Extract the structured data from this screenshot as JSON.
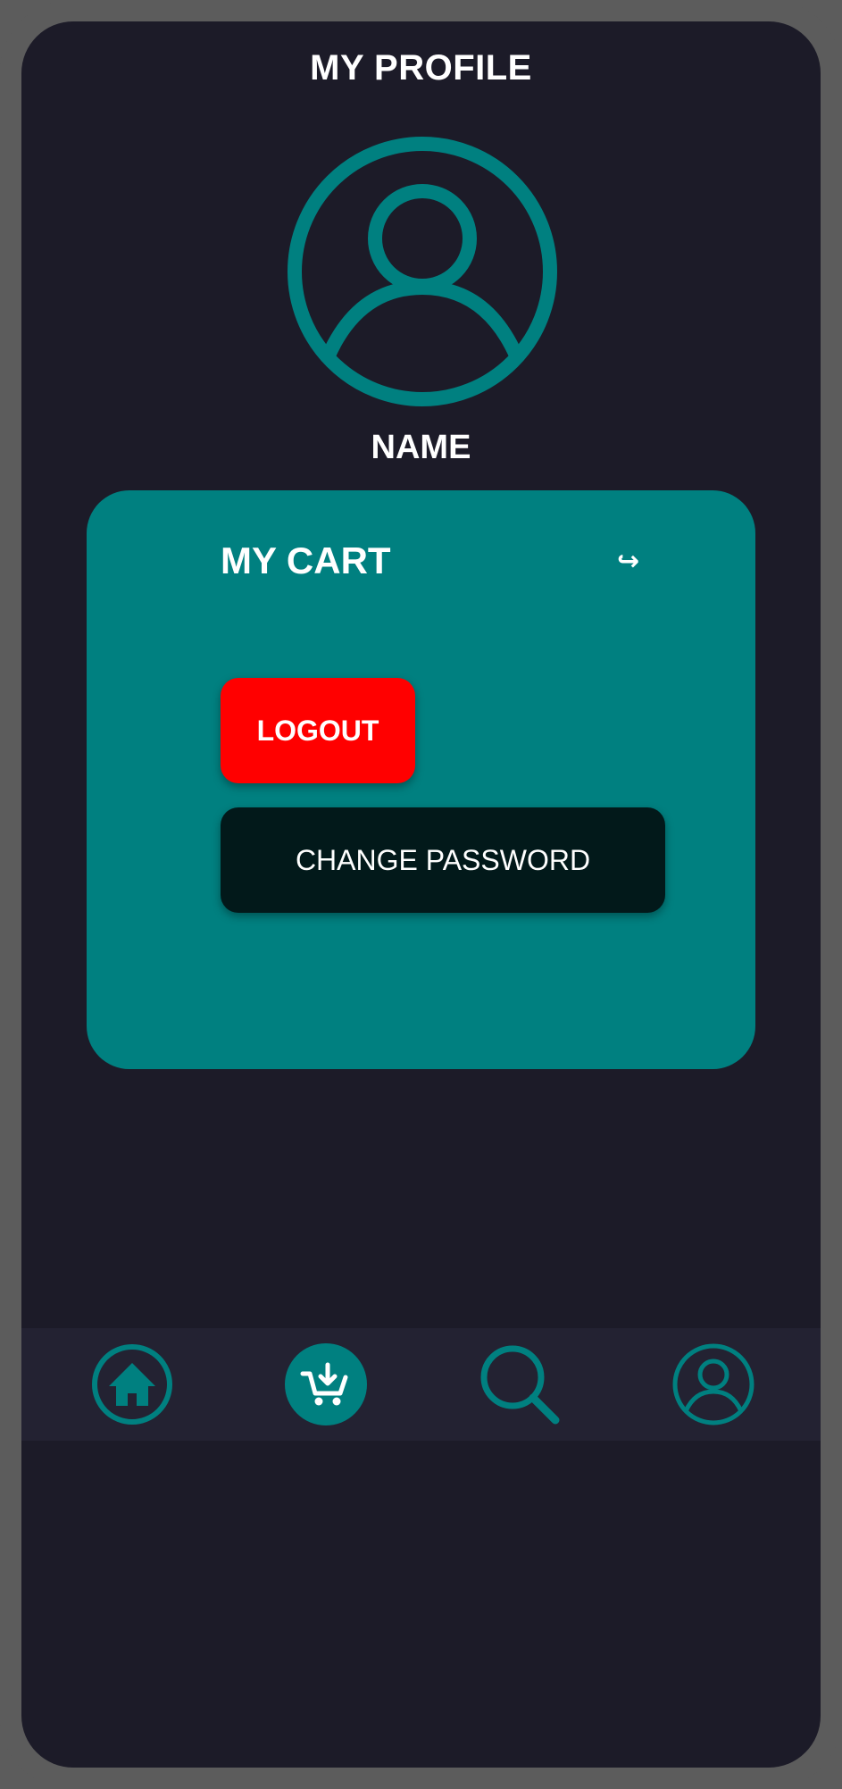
{
  "header": {
    "title": "MY PROFILE"
  },
  "profile": {
    "name": "NAME",
    "avatar_icon": "user-circle-icon"
  },
  "card": {
    "cart_label": "MY CART",
    "cart_arrow": "↪",
    "logout_label": "LOGOUT",
    "change_password_label": "CHANGE PASSWORD"
  },
  "bottom_nav": {
    "items": [
      {
        "icon": "home-icon",
        "active": false
      },
      {
        "icon": "cart-download-icon",
        "active": true
      },
      {
        "icon": "search-icon",
        "active": false
      },
      {
        "icon": "profile-icon",
        "active": false
      }
    ]
  },
  "colors": {
    "background": "#1c1b28",
    "frame": "#5c5c5c",
    "accent": "#008080",
    "danger": "#ff0000",
    "dark_button": "#02191a",
    "nav_bar": "#232232",
    "text": "#ffffff"
  }
}
